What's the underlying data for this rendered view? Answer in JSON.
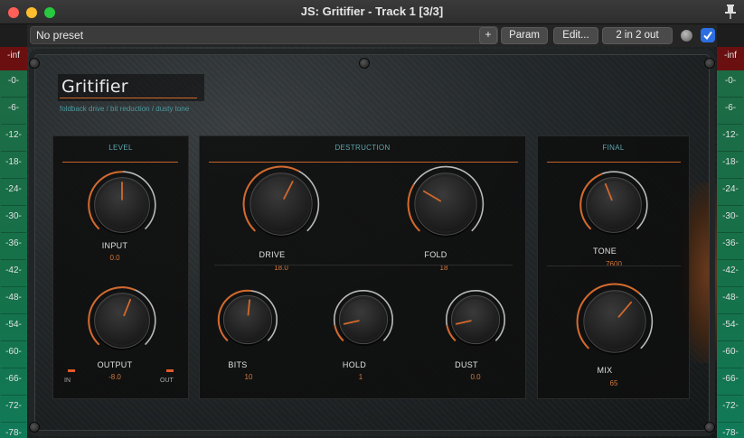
{
  "window": {
    "title": "JS: Gritifier - Track 1 [3/3]"
  },
  "toolbar": {
    "preset_value": "No preset",
    "add_label": "+",
    "param_label": "Param",
    "edit_label": "Edit...",
    "io_label": "2 in 2 out"
  },
  "meter": {
    "ticks": [
      "-inf",
      "-0-",
      "-6-",
      "-12-",
      "-18-",
      "-24-",
      "-30-",
      "-36-",
      "-42-",
      "-48-",
      "-54-",
      "-60-",
      "-66-",
      "-72-",
      "-78-"
    ]
  },
  "plugin": {
    "name": "Gritifier",
    "tagline": "foldback drive / bit reduction / dusty tone",
    "colors": {
      "accent": "#d2692c",
      "teal": "#5fa7ad",
      "value": "#d3793b"
    },
    "sections": {
      "level": {
        "title": "LEVEL",
        "input": {
          "label": "INPUT",
          "value": "0.0",
          "norm": 0.5
        },
        "output": {
          "label": "OUTPUT",
          "value": "-8.0",
          "norm": 0.58
        },
        "in_label": "IN",
        "out_label": "OUT"
      },
      "destruction": {
        "title": "DESTRUCTION",
        "drive": {
          "label": "DRIVE",
          "value": "18.0",
          "norm": 0.6
        },
        "fold": {
          "label": "FOLD",
          "value": "18",
          "norm": 0.28
        },
        "bits": {
          "label": "BITS",
          "value": "10",
          "norm": 0.52
        },
        "hold": {
          "label": "HOLD",
          "value": "1",
          "norm": 0.12
        },
        "dust": {
          "label": "DUST",
          "value": "0.0",
          "norm": 0.12
        }
      },
      "final": {
        "title": "FINAL",
        "tone": {
          "label": "TONE",
          "value": "7600",
          "norm": 0.42
        },
        "mix": {
          "label": "MIX",
          "value": "65",
          "norm": 0.65
        }
      }
    }
  }
}
